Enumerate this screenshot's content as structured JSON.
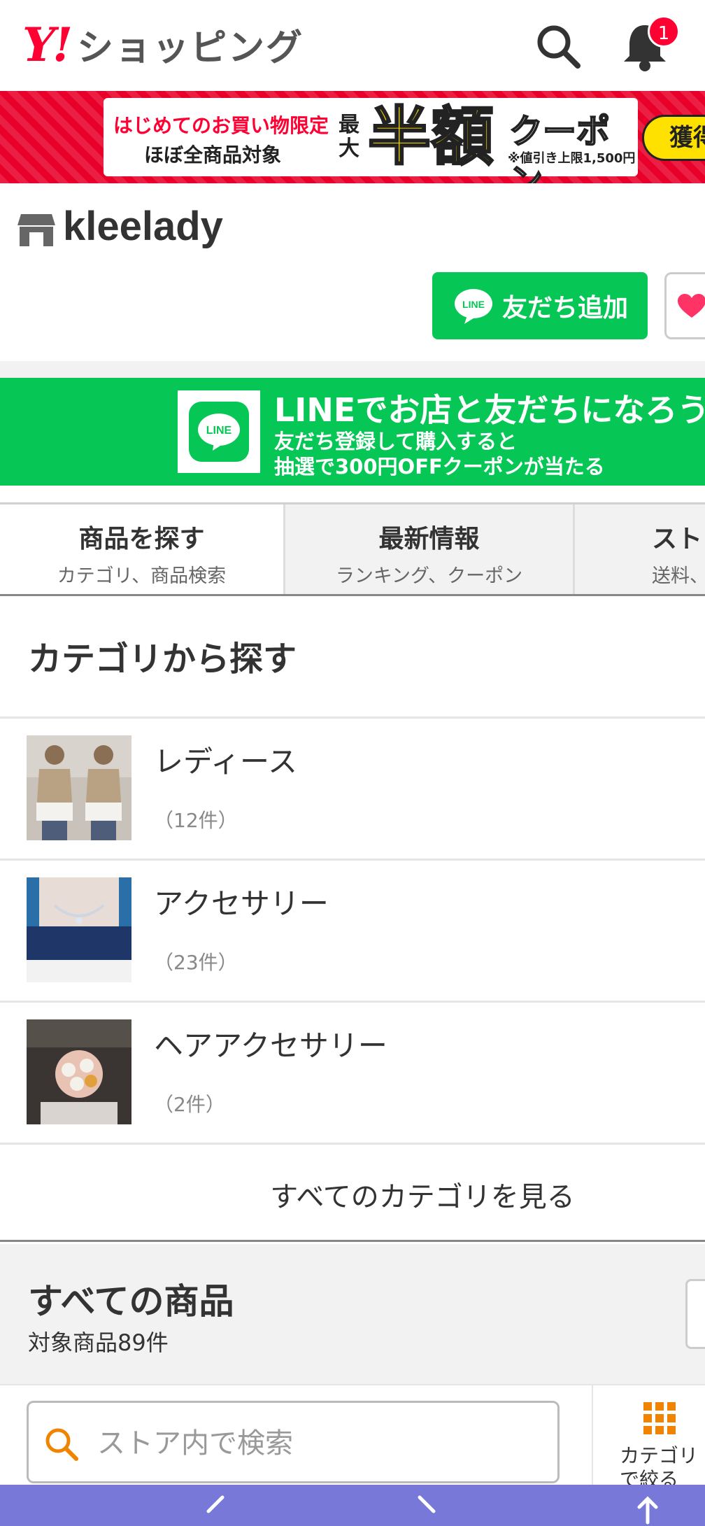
{
  "header": {
    "logo_mark": "Y!",
    "logo_text": "ショッピング",
    "notification_count": "1"
  },
  "coupon_banner": {
    "line1": "はじめてのお買い物限定",
    "line2": "ほぼ全商品対象",
    "max": "最大",
    "big": "半額",
    "word": "クーポン",
    "note": "※値引き上限1,500円",
    "cta": "獲得"
  },
  "store": {
    "name": "kleelady",
    "line_add_label": "友だち追加",
    "line_icon_text": "LINE"
  },
  "line_banner": {
    "logo_text": "LINE",
    "title": "LINEでお店と友だちになろう",
    "sub1": "友だち登録して購入すると",
    "sub2": "抽選で300円OFFクーポンが当たる"
  },
  "tabs": [
    {
      "title": "商品を探す",
      "sub": "カテゴリ、商品検索"
    },
    {
      "title": "最新情報",
      "sub": "ランキング、クーポン"
    },
    {
      "title": "スト",
      "sub": "送料、"
    }
  ],
  "categories": {
    "title": "カテゴリから探す",
    "items": [
      {
        "name": "レディース",
        "count": "（12件）"
      },
      {
        "name": "アクセサリー",
        "count": "（23件）"
      },
      {
        "name": "ヘアアクセサリー",
        "count": "（2件）"
      }
    ],
    "see_all": "すべてのカテゴリを見る"
  },
  "all_products": {
    "title": "すべての商品",
    "count": "対象商品89件"
  },
  "search": {
    "placeholder": "ストア内で検索",
    "filter_label_1": "カテゴリ",
    "filter_label_2": "で絞る"
  },
  "colors": {
    "yahoo_red": "#ff0033",
    "line_green": "#06c755",
    "bottom_bar": "#7878d8",
    "accent_orange": "#f08300"
  }
}
